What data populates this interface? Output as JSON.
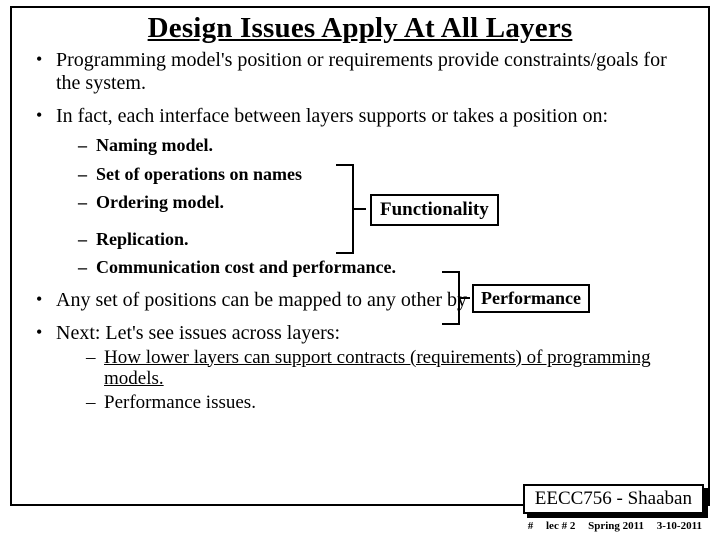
{
  "title": "Design Issues Apply At All Layers",
  "bullets": {
    "b1": "Programming model's position or requirements provide constraints/goals for the system.",
    "b2": "In fact, each interface between layers supports or takes a position on:",
    "b2_sub": {
      "s1": "Naming model.",
      "s2": "Set of operations on names",
      "s3": "Ordering model.",
      "s4": "Replication.",
      "s5": "Communication cost and performance."
    },
    "b3": "Any set of positions can be mapped to any other by software.",
    "b4": "Next: Let's see issues across layers:",
    "b4_sub": {
      "s1": "How lower layers can support contracts (requirements) of programming models.",
      "s2": "Performance issues."
    }
  },
  "labels": {
    "functionality": "Functionality",
    "performance": "Performance"
  },
  "footer": {
    "course": "EECC756 - Shaaban",
    "pageno": "#",
    "lec": "lec # 2",
    "term": "Spring 2011",
    "date": "3-10-2011"
  }
}
